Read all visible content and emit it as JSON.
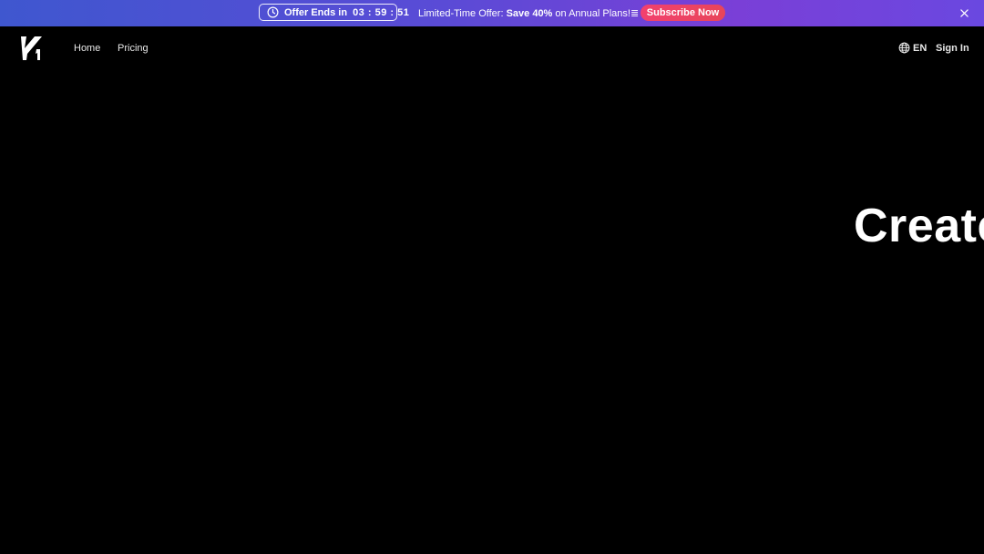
{
  "promo": {
    "offer_label": "Offer Ends in",
    "countdown": "03 : 59 : 51",
    "text_prefix": "Limited-Time Offer: ",
    "text_bold": "Save 40%",
    "text_suffix": " on Annual Plans!",
    "emoji": "≣",
    "subscribe_label": "Subscribe Now",
    "icons": {
      "clock": "clock-icon",
      "close": "close-icon"
    },
    "colors": {
      "gradient_start": "#3f57cf",
      "gradient_end": "#7a3fd7",
      "button": "#f2416e"
    }
  },
  "nav": {
    "logo": "k1-logo",
    "links": [
      {
        "label": "Home"
      },
      {
        "label": "Pricing"
      }
    ],
    "language": "EN",
    "language_icon": "globe-icon",
    "sign_in": "Sign In"
  },
  "hero": {
    "title": "Create"
  }
}
